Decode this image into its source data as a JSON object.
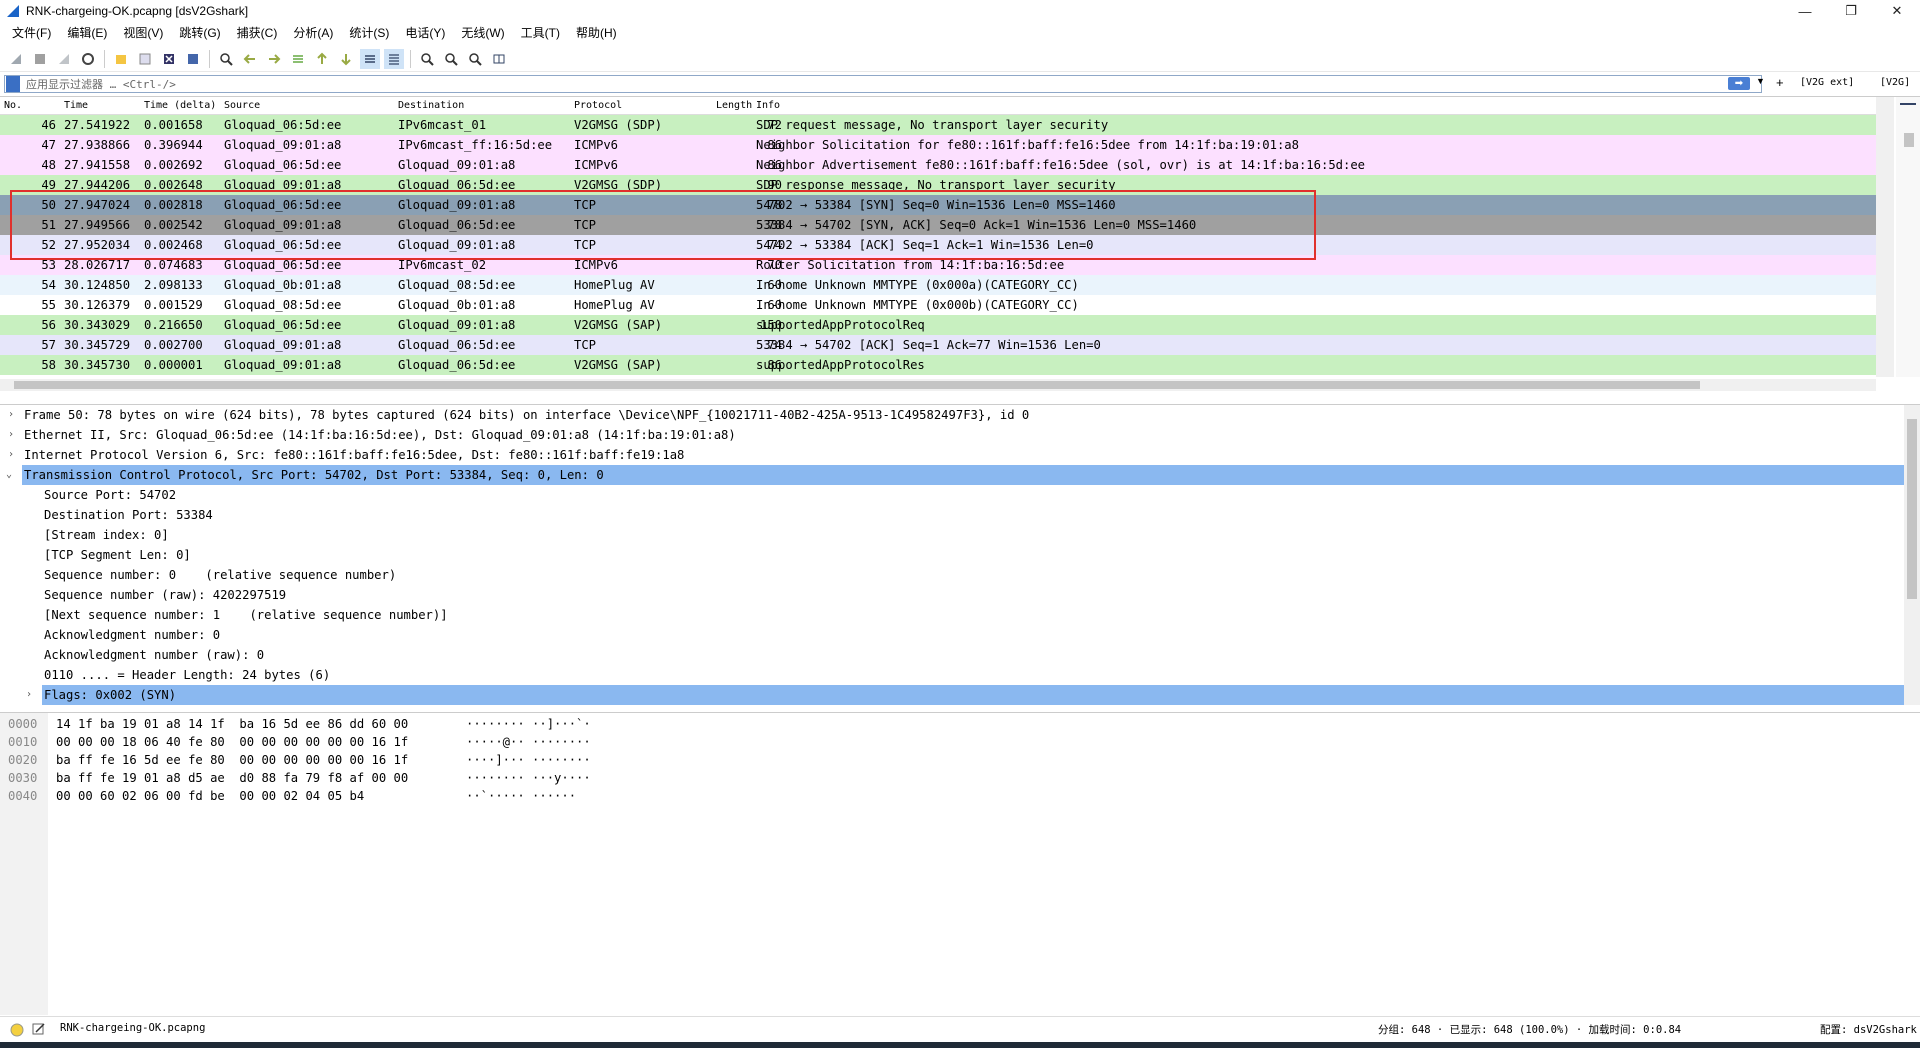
{
  "window": {
    "title": "RNK-chargeing-OK.pcapng [dsV2Gshark]",
    "controls": [
      "—",
      "❐",
      "✕"
    ]
  },
  "menu": [
    "文件(F)",
    "编辑(E)",
    "视图(V)",
    "跳转(G)",
    "捕获(C)",
    "分析(A)",
    "统计(S)",
    "电话(Y)",
    "无线(W)",
    "工具(T)",
    "帮助(H)"
  ],
  "filter": {
    "placeholder": "应用显示过滤器 … <Ctrl-/>",
    "plus": "+",
    "buttons": [
      "[V2G ext]",
      "[V2G]"
    ]
  },
  "packet_list": {
    "columns": [
      "No.",
      "Time",
      "Time (delta)",
      "Source",
      "Destination",
      "Protocol",
      "Length",
      "Info"
    ],
    "rows": [
      {
        "no": "46",
        "time": "27.541922",
        "delta": "0.001658",
        "src": "Gloquad_06:5d:ee",
        "dst": "IPv6mcast_01",
        "proto": "V2GMSG (SDP)",
        "len": "72",
        "info": "SDP request message, No transport layer security",
        "bg": "#c8f0c0"
      },
      {
        "no": "47",
        "time": "27.938866",
        "delta": "0.396944",
        "src": "Gloquad_09:01:a8",
        "dst": "IPv6mcast_ff:16:5d:ee",
        "proto": "ICMPv6",
        "len": "86",
        "info": "Neighbor Solicitation for fe80::161f:baff:fe16:5dee from 14:1f:ba:19:01:a8",
        "bg": "#fce0ff"
      },
      {
        "no": "48",
        "time": "27.941558",
        "delta": "0.002692",
        "src": "Gloquad_06:5d:ee",
        "dst": "Gloquad_09:01:a8",
        "proto": "ICMPv6",
        "len": "86",
        "info": "Neighbor Advertisement fe80::161f:baff:fe16:5dee (sol, ovr) is at 14:1f:ba:16:5d:ee",
        "bg": "#fce0ff"
      },
      {
        "no": "49",
        "time": "27.944206",
        "delta": "0.002648",
        "src": "Gloquad_09:01:a8",
        "dst": "Gloquad_06:5d:ee",
        "proto": "V2GMSG (SDP)",
        "len": "90",
        "info": "SDP response message, No transport layer security",
        "bg": "#c8f0c0"
      },
      {
        "no": "50",
        "time": "27.947024",
        "delta": "0.002818",
        "src": "Gloquad_06:5d:ee",
        "dst": "Gloquad_09:01:a8",
        "proto": "TCP",
        "len": "78",
        "info": "54702 → 53384 [SYN] Seq=0 Win=1536 Len=0 MSS=1460",
        "bg": "#8aa0b4"
      },
      {
        "no": "51",
        "time": "27.949566",
        "delta": "0.002542",
        "src": "Gloquad_09:01:a8",
        "dst": "Gloquad_06:5d:ee",
        "proto": "TCP",
        "len": "78",
        "info": "53384 → 54702 [SYN, ACK] Seq=0 Ack=1 Win=1536 Len=0 MSS=1460",
        "bg": "#a0a0a0"
      },
      {
        "no": "52",
        "time": "27.952034",
        "delta": "0.002468",
        "src": "Gloquad_06:5d:ee",
        "dst": "Gloquad_09:01:a8",
        "proto": "TCP",
        "len": "74",
        "info": "54702 → 53384 [ACK] Seq=1 Ack=1 Win=1536 Len=0",
        "bg": "#e6e6fa"
      },
      {
        "no": "53",
        "time": "28.026717",
        "delta": "0.074683",
        "src": "Gloquad_06:5d:ee",
        "dst": "IPv6mcast_02",
        "proto": "ICMPv6",
        "len": "70",
        "info": "Router Solicitation from 14:1f:ba:16:5d:ee",
        "bg": "#fce0ff"
      },
      {
        "no": "54",
        "time": "30.124850",
        "delta": "2.098133",
        "src": "Gloquad_0b:01:a8",
        "dst": "Gloquad_08:5d:ee",
        "proto": "HomePlug AV",
        "len": "60",
        "info": "In-home Unknown MMTYPE (0x000a)(CATEGORY_CC)",
        "bg": "#eaf4fc"
      },
      {
        "no": "55",
        "time": "30.126379",
        "delta": "0.001529",
        "src": "Gloquad_08:5d:ee",
        "dst": "Gloquad_0b:01:a8",
        "proto": "HomePlug AV",
        "len": "60",
        "info": "In-home Unknown MMTYPE (0x000b)(CATEGORY_CC)",
        "bg": "#ffffff"
      },
      {
        "no": "56",
        "time": "30.343029",
        "delta": "0.216650",
        "src": "Gloquad_06:5d:ee",
        "dst": "Gloquad_09:01:a8",
        "proto": "V2GMSG (SAP)",
        "len": "150",
        "info": "supportedAppProtocolReq",
        "bg": "#c8f0c0"
      },
      {
        "no": "57",
        "time": "30.345729",
        "delta": "0.002700",
        "src": "Gloquad_09:01:a8",
        "dst": "Gloquad_06:5d:ee",
        "proto": "TCP",
        "len": "74",
        "info": "53384 → 54702 [ACK] Seq=1 Ack=77 Win=1536 Len=0",
        "bg": "#e6e6fa"
      },
      {
        "no": "58",
        "time": "30.345730",
        "delta": "0.000001",
        "src": "Gloquad_09:01:a8",
        "dst": "Gloquad_06:5d:ee",
        "proto": "V2GMSG (SAP)",
        "len": "86",
        "info": "supportedAppProtocolRes",
        "bg": "#c8f0c0"
      }
    ]
  },
  "details": [
    {
      "arrow": ">",
      "indent": 0,
      "text": "Frame 50: 78 bytes on wire (624 bits), 78 bytes captured (624 bits) on interface \\Device\\NPF_{10021711-40B2-425A-9513-1C49582497F3}, id 0",
      "selected": false
    },
    {
      "arrow": ">",
      "indent": 0,
      "text": "Ethernet II, Src: Gloquad_06:5d:ee (14:1f:ba:16:5d:ee), Dst: Gloquad_09:01:a8 (14:1f:ba:19:01:a8)",
      "selected": false
    },
    {
      "arrow": ">",
      "indent": 0,
      "text": "Internet Protocol Version 6, Src: fe80::161f:baff:fe16:5dee, Dst: fe80::161f:baff:fe19:1a8",
      "selected": false
    },
    {
      "arrow": "v",
      "indent": 0,
      "text": "Transmission Control Protocol, Src Port: 54702, Dst Port: 53384, Seq: 0, Len: 0",
      "selected": true
    },
    {
      "arrow": "",
      "indent": 1,
      "text": "Source Port: 54702",
      "selected": false
    },
    {
      "arrow": "",
      "indent": 1,
      "text": "Destination Port: 53384",
      "selected": false
    },
    {
      "arrow": "",
      "indent": 1,
      "text": "[Stream index: 0]",
      "selected": false
    },
    {
      "arrow": "",
      "indent": 1,
      "text": "[TCP Segment Len: 0]",
      "selected": false
    },
    {
      "arrow": "",
      "indent": 1,
      "text": "Sequence number: 0    (relative sequence number)",
      "selected": false
    },
    {
      "arrow": "",
      "indent": 1,
      "text": "Sequence number (raw): 4202297519",
      "selected": false
    },
    {
      "arrow": "",
      "indent": 1,
      "text": "[Next sequence number: 1    (relative sequence number)]",
      "selected": false
    },
    {
      "arrow": "",
      "indent": 1,
      "text": "Acknowledgment number: 0",
      "selected": false
    },
    {
      "arrow": "",
      "indent": 1,
      "text": "Acknowledgment number (raw): 0",
      "selected": false
    },
    {
      "arrow": "",
      "indent": 1,
      "text": "0110 .... = Header Length: 24 bytes (6)",
      "selected": false
    },
    {
      "arrow": ">",
      "indent": 1,
      "text": "Flags: 0x002 (SYN)",
      "selected": true
    }
  ],
  "bytes": [
    {
      "offset": "0000",
      "hex": "14 1f ba 19 01 a8 14 1f  ba 16 5d ee 86 dd 60 00",
      "ascii": "········ ··]···`·"
    },
    {
      "offset": "0010",
      "hex": "00 00 00 18 06 40 fe 80  00 00 00 00 00 00 16 1f",
      "ascii": "·····@·· ········"
    },
    {
      "offset": "0020",
      "hex": "ba ff fe 16 5d ee fe 80  00 00 00 00 00 00 16 1f",
      "ascii": "····]··· ········"
    },
    {
      "offset": "0030",
      "hex": "ba ff fe 19 01 a8 d5 ae  d0 88 fa 79 f8 af 00 00",
      "ascii": "········ ···y····"
    },
    {
      "offset": "0040",
      "hex": "00 00 60 02 06 00 fd be  00 00 02 04 05 b4",
      "ascii": "··`····· ······"
    }
  ],
  "status": {
    "file": "RNK-chargeing-OK.pcapng",
    "stats": "分组: 648 · 已显示: 648 (100.0%) · 加载时间: 0:0.84",
    "profile": "配置: dsV2Gshark"
  },
  "colors": {
    "selected_detail": "#8ab8f0",
    "highlight_box": "#e0302c"
  }
}
